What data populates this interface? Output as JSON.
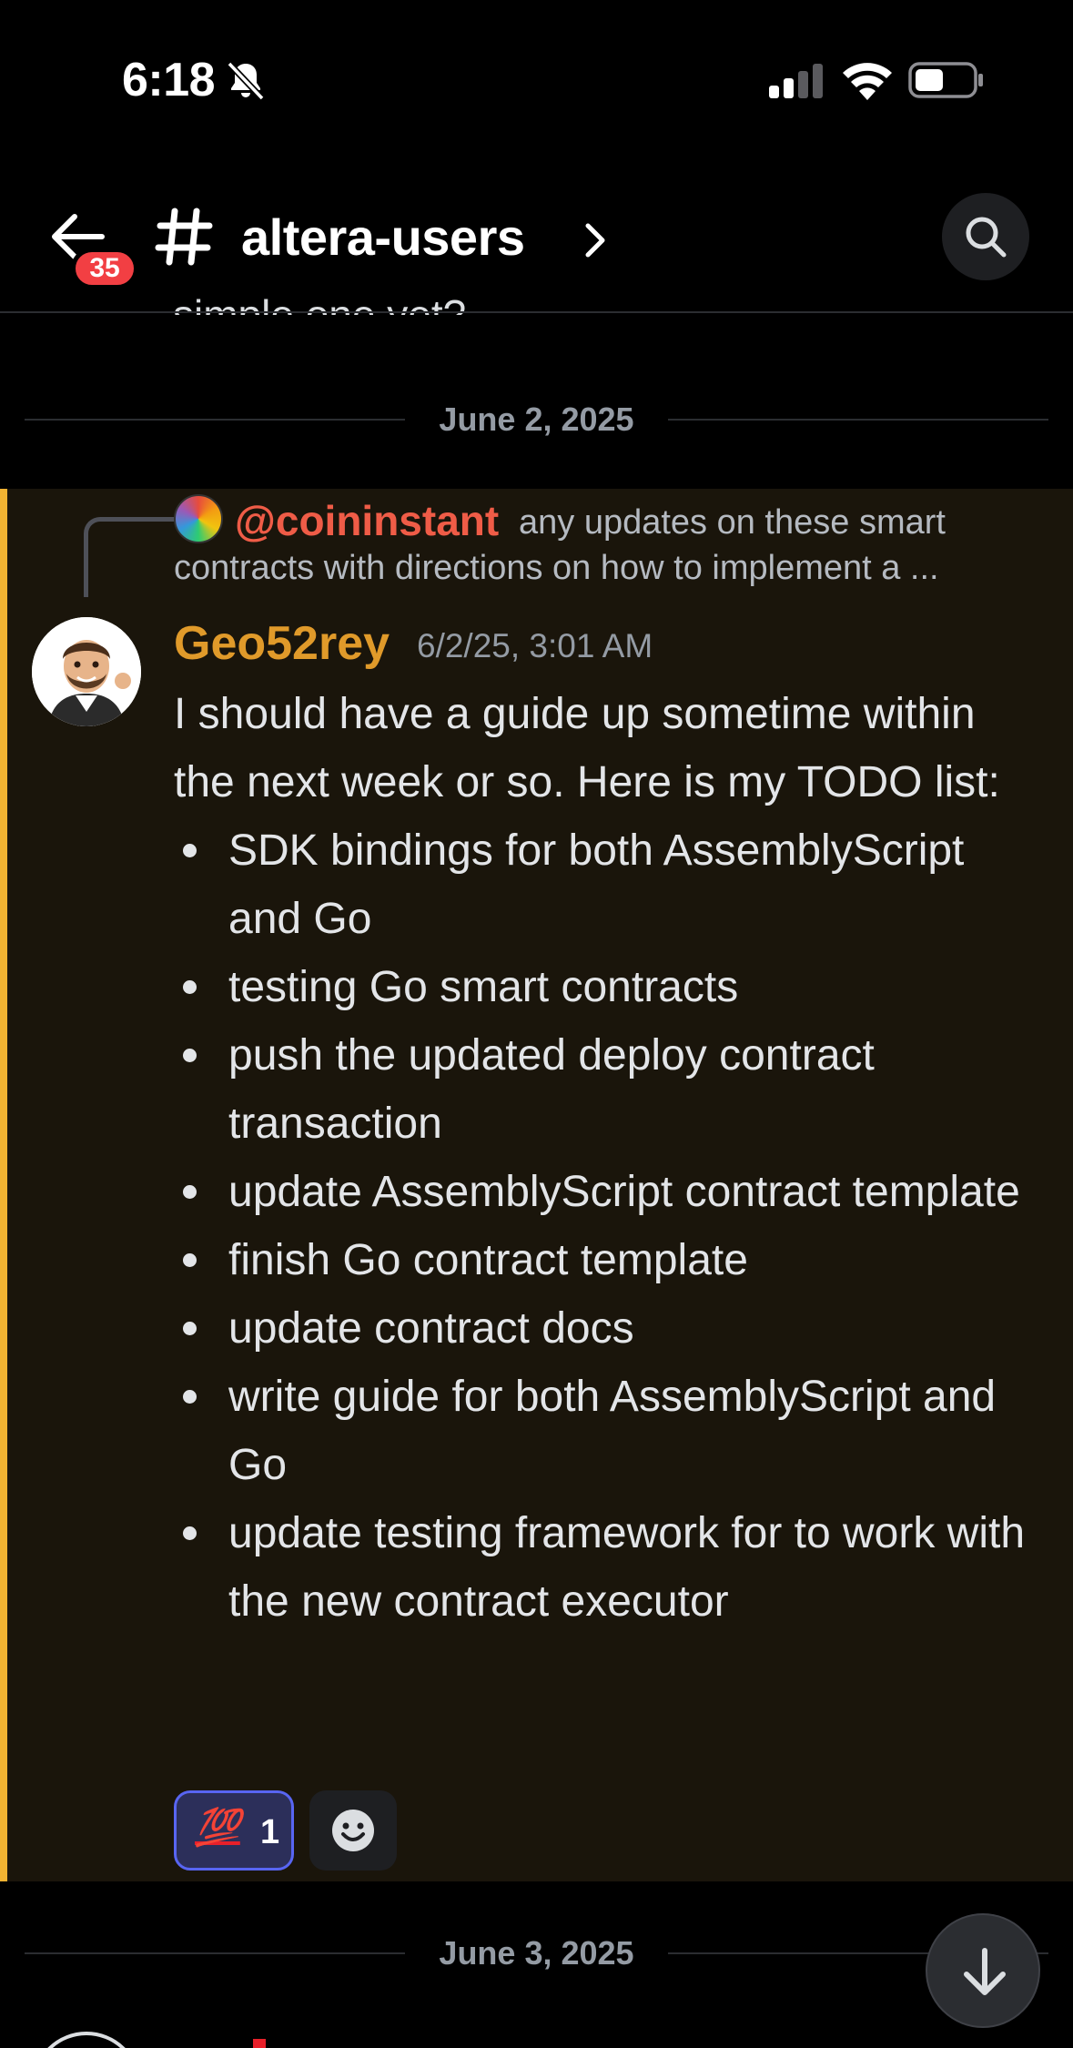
{
  "status_bar": {
    "time": "6:18",
    "icons": [
      "bell-slash-icon",
      "cellular-signal-icon",
      "wifi-icon",
      "battery-icon"
    ]
  },
  "header": {
    "unread_count": "35",
    "channel_name": "altera-users",
    "icons": [
      "back-arrow-icon",
      "hash-icon",
      "chevron-right-icon",
      "search-icon"
    ]
  },
  "previous_message": {
    "cut_text": "simple one yet?"
  },
  "date_dividers": {
    "first": "June 2, 2025",
    "second": "June 3, 2025"
  },
  "message": {
    "reply": {
      "mention": "@coininstant",
      "preview_line1": "any updates on these smart",
      "preview_line2": "contracts with directions on how to implement a ..."
    },
    "author": "Geo52rey",
    "timestamp": "6/2/25, 3:01 AM",
    "intro": "I should have a guide up sometime within the next week or so. Here is my TODO list:",
    "todo": [
      "SDK bindings for both AssemblyScript and Go",
      "testing Go smart contracts",
      "push the updated deploy contract transaction",
      "update AssemblyScript contract template",
      "finish Go contract template",
      "update contract docs",
      "write guide for both AssemblyScript and Go",
      "update testing framework for to work with the new contract executor"
    ],
    "reactions": [
      {
        "emoji": "💯",
        "count": "1"
      }
    ]
  },
  "colors": {
    "highlight_bg": "#1a150b",
    "highlight_border": "#f0b232",
    "author_name": "#e09a2a",
    "mention": "#ef5c47",
    "badge": "#f23f43",
    "reaction_border": "#5865f2"
  }
}
